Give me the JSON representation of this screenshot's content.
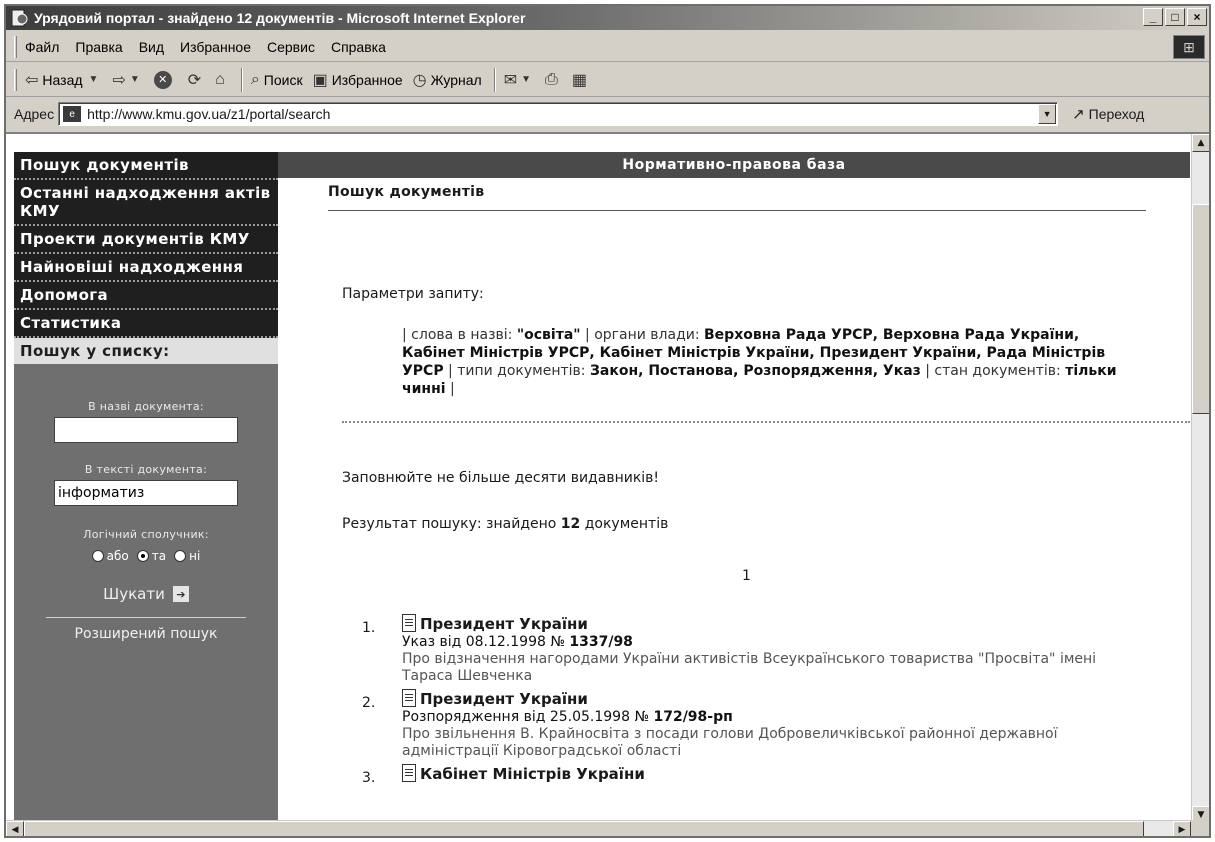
{
  "window": {
    "title": "Урядовий портал - знайдено 12 документів - Microsoft Internet Explorer"
  },
  "menu": [
    {
      "label": "Файл"
    },
    {
      "label": "Правка"
    },
    {
      "label": "Вид"
    },
    {
      "label": "Избранное"
    },
    {
      "label": "Сервис"
    },
    {
      "label": "Справка"
    }
  ],
  "toolbar": {
    "back": "Назад",
    "search": "Поиск",
    "favorites": "Избранное",
    "history": "Журнал"
  },
  "address": {
    "label": "Адрес",
    "url": "http://www.kmu.gov.ua/z1/portal/search",
    "go": "Переход"
  },
  "sidebar": {
    "nav": [
      {
        "label": "Пошук документів"
      },
      {
        "label": "Останні надходження актів КМУ"
      },
      {
        "label": "Проекти документів КМУ"
      },
      {
        "label": "Найновіші надходження"
      },
      {
        "label": "Допомога"
      },
      {
        "label": "Статистика"
      }
    ],
    "list_search_title": "Пошук у списку:",
    "name_label": "В назві документа:",
    "name_value": "",
    "text_label": "В тексті документа:",
    "text_value": "інформатиз",
    "logic_label": "Логічний сполучник:",
    "radios": [
      {
        "label": "або"
      },
      {
        "label": "та"
      },
      {
        "label": "ні"
      }
    ],
    "search_button": "Шукати",
    "advanced_link": "Розширений пошук"
  },
  "main": {
    "banner": "Нормативно-правова база",
    "heading": "Пошук документів",
    "params_title": "Параметри запиту:",
    "params": {
      "p1": "| слова в назві: ",
      "words": "\"освіта\"",
      "p2": " | органи влади: ",
      "authorities": "Верховна Рада УРСР, Верховна Рада України, Кабінет Міністрів УРСР, Кабінет Міністрів України, Президент України, Рада Міністрів УРСР",
      "p3": " | типи документів: ",
      "types": "Закон, Постанова, Розпорядження, Указ",
      "p4": " | стан документів: ",
      "state": "тільки чинні",
      "p5": " |"
    },
    "warning": "Заповнюйте не більше десяти видавників!",
    "result_prefix": "Результат пошуку: знайдено ",
    "result_count": "12",
    "result_suffix": " документів",
    "page_number": "1"
  },
  "results": [
    {
      "num": "1.",
      "org": "Президент України",
      "type_date": "Указ  від 08.12.1998  №",
      "number": "1337/98",
      "desc": "Про відзначення нагородами України активістів Всеукраїнського товариства \"Просвіта\" імені Тараса Шевченка"
    },
    {
      "num": "2.",
      "org": "Президент України",
      "type_date": "Розпорядження  від 25.05.1998  №",
      "number": "172/98-рп",
      "desc": "Про звільнення В. Крайносвіта з посади голови Добровеличківської районної державної адміністрації Кіровоградської області"
    },
    {
      "num": "3.",
      "org": "Кабінет Міністрів України",
      "type_date": "",
      "number": "",
      "desc": ""
    }
  ]
}
